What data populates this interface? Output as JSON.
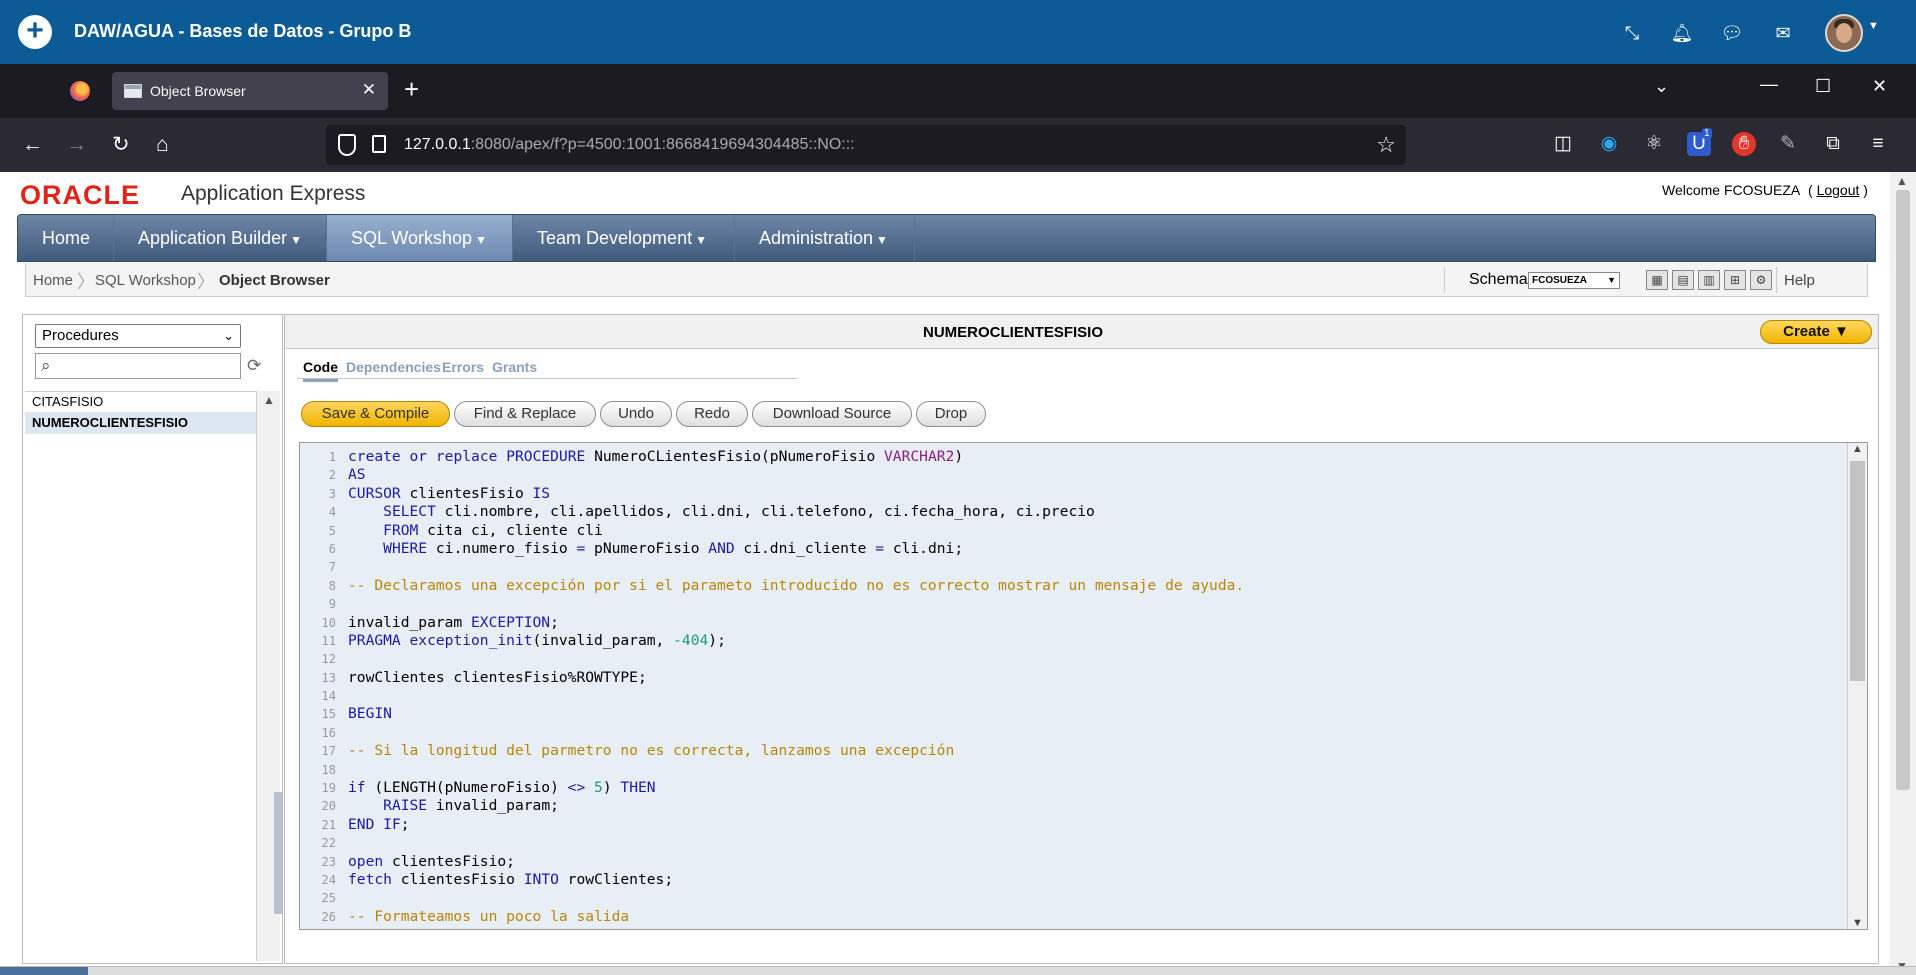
{
  "app_bar": {
    "title": "DAW/AGUA - Bases de Datos - Grupo B",
    "icons": [
      "minimize-arrows-icon",
      "bell-icon",
      "chat-icon",
      "mail-icon"
    ]
  },
  "browser": {
    "tab_title": "Object Browser",
    "url_host": "127.0.0.1",
    "url_rest": ":8080/apex/f?p=4500:1001:8668419694304485::NO:::",
    "extension_badge": "1"
  },
  "apex": {
    "logo": "ORACLE",
    "product": "Application Express",
    "welcome": "Welcome FCOSUEZA",
    "logout": "Logout",
    "nav": [
      {
        "label": "Home"
      },
      {
        "label": "Application Builder"
      },
      {
        "label": "SQL Workshop"
      },
      {
        "label": "Team Development"
      },
      {
        "label": "Administration"
      }
    ],
    "breadcrumb": [
      "Home",
      "SQL Workshop",
      "Object Browser"
    ],
    "schema_label": "Schema",
    "schema_value": "FCOSUEZA",
    "help": "Help"
  },
  "object_browser": {
    "object_type": "Procedures",
    "search_placeholder": "",
    "items": [
      "CITASFISIO",
      "NUMEROCLIENTESFISIO"
    ],
    "selected_item": "NUMEROCLIENTESFISIO"
  },
  "detail": {
    "object_name": "NUMEROCLIENTESFISIO",
    "create_label": "Create",
    "tabs": [
      "Code",
      "Dependencies",
      "Errors",
      "Grants"
    ],
    "active_tab": "Code",
    "buttons": [
      "Save & Compile",
      "Find & Replace",
      "Undo",
      "Redo",
      "Download Source",
      "Drop"
    ]
  },
  "code_lines": [
    "create or replace PROCEDURE NumeroCLientesFisio(pNumeroFisio VARCHAR2)",
    "AS",
    "CURSOR clientesFisio IS",
    "    SELECT cli.nombre, cli.apellidos, cli.dni, cli.telefono, ci.fecha_hora, ci.precio",
    "    FROM cita ci, cliente cli",
    "    WHERE ci.numero_fisio = pNumeroFisio AND ci.dni_cliente = cli.dni;",
    "",
    "-- Declaramos una excepción por si el parameto introducido no es correcto mostrar un mensaje de ayuda.",
    "",
    "invalid_param EXCEPTION;",
    "PRAGMA exception_init(invalid_param, -404);",
    "",
    "rowClientes clientesFisio%ROWTYPE;",
    "",
    "BEGIN",
    "",
    "-- Si la longitud del parmetro no es correcta, lanzamos una excepción",
    "",
    "if (LENGTH(pNumeroFisio) <> 5) THEN",
    "    RAISE invalid_param;",
    "END IF;",
    "",
    "open clientesFisio;",
    "fetch clientesFisio INTO rowClientes;",
    "",
    "-- Formateamos un poco la salida"
  ]
}
